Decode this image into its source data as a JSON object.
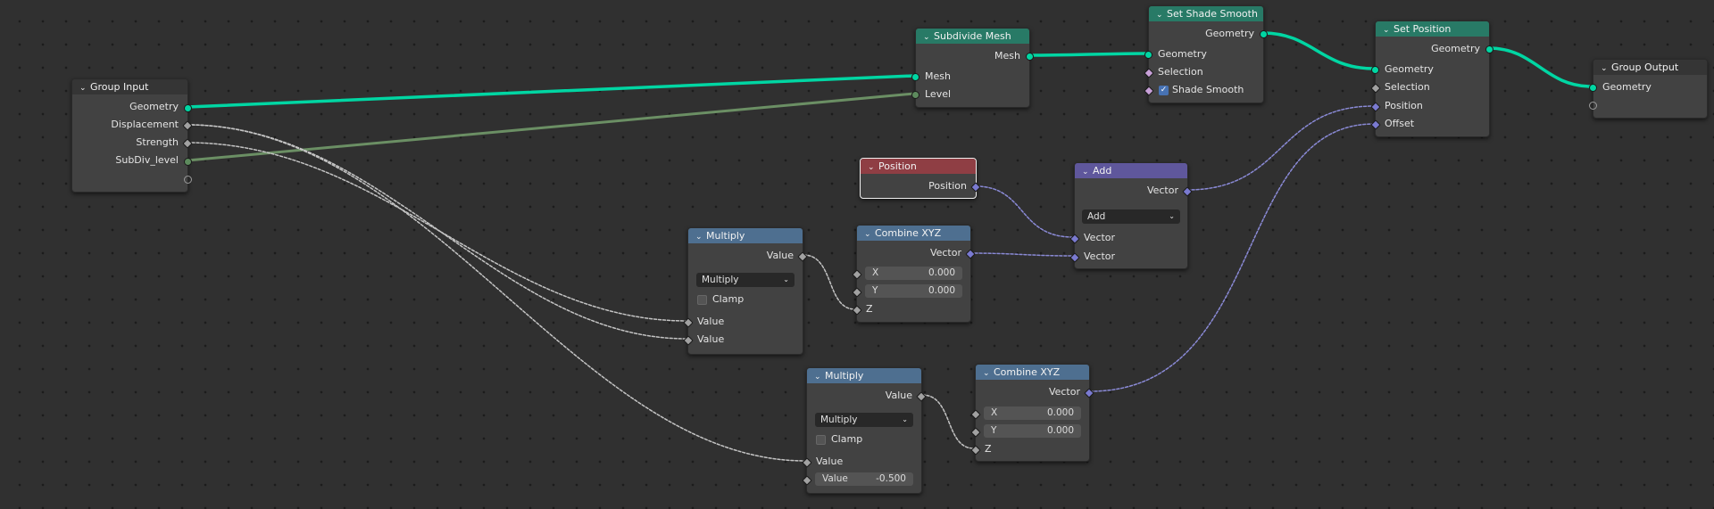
{
  "colors": {
    "geometry": "#00d6a3",
    "int": "#5d8a5d",
    "float": "#a1a1a1",
    "vector": "#6363c7",
    "header_group": "#353535",
    "header_geometry": "#287a66",
    "header_math": "#4e6f90",
    "header_vector": "#5f579c",
    "header_input": "#8f3e44"
  },
  "nodes": {
    "group_input": {
      "title": "Group Input",
      "outputs": [
        "Geometry",
        "Displacement",
        "Strength",
        "SubDiv_level"
      ]
    },
    "subdivide_mesh": {
      "title": "Subdivide Mesh",
      "output": "Mesh",
      "inputs": [
        "Mesh",
        "Level"
      ]
    },
    "set_shade_smooth": {
      "title": "Set Shade Smooth",
      "output": "Geometry",
      "inputs": [
        "Geometry",
        "Selection",
        "Shade Smooth"
      ],
      "shade_smooth_checked": true
    },
    "set_position": {
      "title": "Set Position",
      "output": "Geometry",
      "inputs": [
        "Geometry",
        "Selection",
        "Position",
        "Offset"
      ]
    },
    "group_output": {
      "title": "Group Output",
      "inputs": [
        "Geometry"
      ]
    },
    "position": {
      "title": "Position",
      "output": "Position"
    },
    "add": {
      "title": "Add",
      "output": "Vector",
      "operation": "Add",
      "inputs": [
        "Vector",
        "Vector"
      ]
    },
    "multiply1": {
      "title": "Multiply",
      "output": "Value",
      "operation": "Multiply",
      "clamp_label": "Clamp",
      "inputs": [
        "Value",
        "Value"
      ]
    },
    "combine1": {
      "title": "Combine XYZ",
      "output": "Vector",
      "x_label": "X",
      "x_value": "0.000",
      "y_label": "Y",
      "y_value": "0.000",
      "z_label": "Z"
    },
    "multiply2": {
      "title": "Multiply",
      "output": "Value",
      "operation": "Multiply",
      "clamp_label": "Clamp",
      "input_value": "Value",
      "value_label": "Value",
      "value_field": "-0.500"
    },
    "combine2": {
      "title": "Combine XYZ",
      "output": "Vector",
      "x_label": "X",
      "x_value": "0.000",
      "y_label": "Y",
      "y_value": "0.000",
      "z_label": "Z"
    }
  }
}
